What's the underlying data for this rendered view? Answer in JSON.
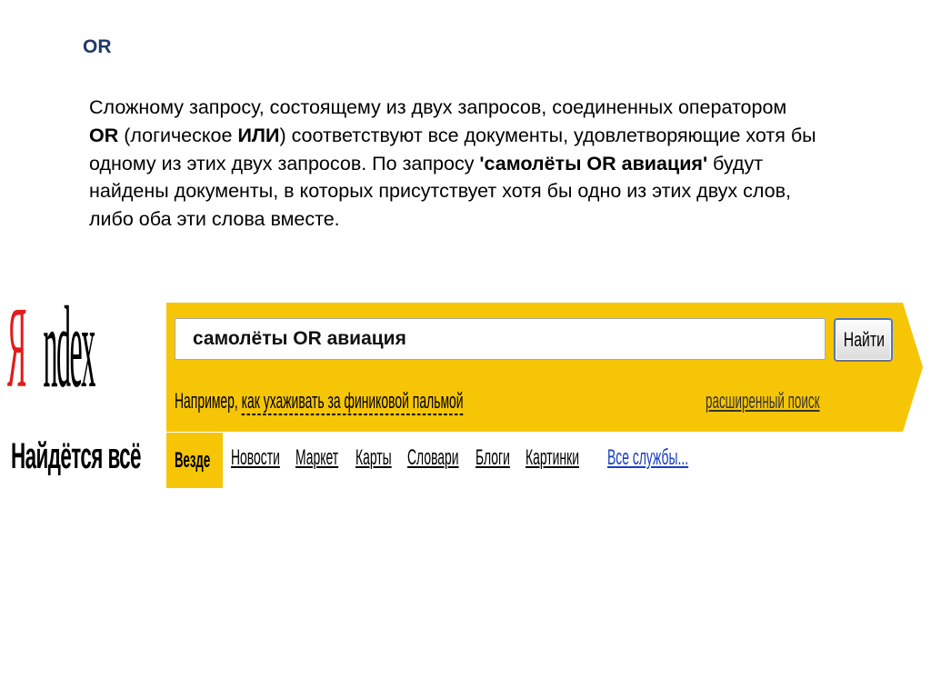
{
  "slide": {
    "title": "OR",
    "paragraph": [
      {
        "text": "Сложному запросу, состоящему из двух запросов, соединенных оператором ",
        "bold": false
      },
      {
        "text": "OR",
        "bold": true
      },
      {
        "text": " (логическое ",
        "bold": false
      },
      {
        "text": "ИЛИ",
        "bold": true
      },
      {
        "text": ") соответствуют все документы, удовлетворяющие хотя бы одному из этих двух запросов. По запросу ",
        "bold": false
      },
      {
        "text": "'самолёты OR авиация'",
        "bold": true
      },
      {
        "text": " будут найдены документы, в которых присутствует хотя бы одно из этих двух слов, либо оба эти слова вместе.",
        "bold": false
      }
    ]
  },
  "logo": {
    "first_letter": "Я",
    "rest": "ndex",
    "slogan": "Найдётся всё"
  },
  "search": {
    "query": "самолёты OR авиация",
    "button_label": "Найти",
    "example_prefix": "Например, ",
    "example_link": "как ухаживать за финиковой пальмой",
    "advanced_link": "расширенный поиск"
  },
  "tabs": {
    "active": "Везде",
    "items": [
      "Новости",
      "Маркет",
      "Карты",
      "Словари",
      "Блоги",
      "Картинки"
    ],
    "all_services": "Все службы..."
  },
  "colors": {
    "panel": "#f6c506",
    "logo_red": "#e31b1b",
    "title": "#1f3a68",
    "services_link": "#1a3dc1"
  }
}
